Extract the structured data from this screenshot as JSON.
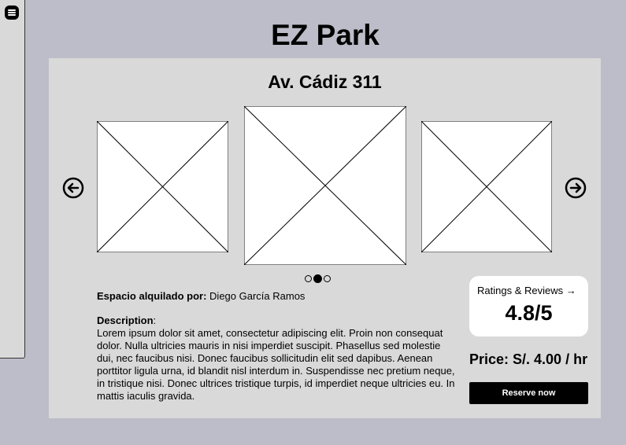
{
  "app": {
    "title": "EZ Park"
  },
  "listing": {
    "address": "Av. Cádiz 311",
    "owner_label": "Espacio alquilado por:",
    "owner_name": "Diego García Ramos",
    "description_label": "Description",
    "description_colon": ":",
    "description_text": "Lorem ipsum dolor sit amet, consectetur adipiscing elit. Proin non consequat dolor. Nulla ultricies mauris in nisi imperdiet suscipit. Phasellus sed molestie dui, nec faucibus nisi. Donec faucibus sollicitudin elit sed dapibus. Aenean porttitor ligula urna, id blandit nisl interdum in. Suspendisse nec pretium neque, in tristique nisi. Donec ultrices tristique turpis, id imperdiet neque ultricies eu. In mattis iaculis gravida."
  },
  "carousel": {
    "image_count": 3,
    "active_index": 1
  },
  "ratings": {
    "label": "Ratings & Reviews",
    "arrow": "→",
    "value": "4.8/5"
  },
  "price": {
    "text": "Price: S/. 4.00 / hr"
  },
  "actions": {
    "reserve_label": "Reserve now"
  },
  "icons": {
    "menu": "menu-icon",
    "prev": "arrow-left-circle-icon",
    "next": "arrow-right-circle-icon",
    "image_placeholder": "image-placeholder-icon"
  }
}
